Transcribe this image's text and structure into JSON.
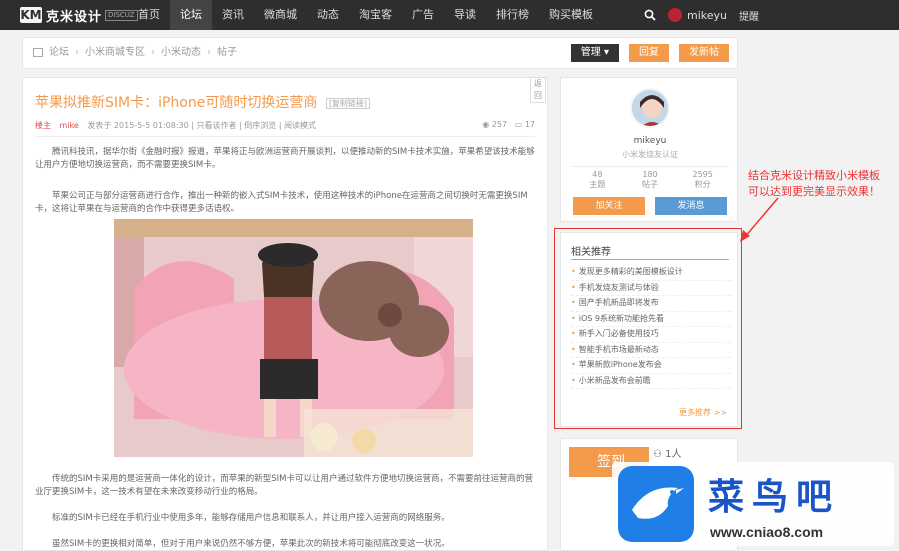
{
  "nav": {
    "logo_mark": "KM",
    "logo_text": "克米设计",
    "logo_badge": "DISCUZ",
    "items": [
      "首页",
      "论坛",
      "资讯",
      "微商城",
      "动态",
      "淘宝客",
      "广告",
      "导读",
      "排行榜",
      "购买模板"
    ],
    "active_index": 1,
    "user": "mikeyu",
    "flag": "提醒"
  },
  "breadcrumb": {
    "items": [
      "论坛",
      "小米商城专区",
      "小米动态",
      "帖子"
    ],
    "buttons": [
      "管理",
      "回复",
      "发新帖"
    ]
  },
  "article": {
    "side_tab": "返回",
    "title": "苹果拟推新SIM卡：iPhone可随时切换运营商",
    "tag": "[复制链接]",
    "author": "楼主",
    "author2": "mike",
    "meta": "发表于 2015-5-5 01:08:30 | 只看该作者 | 倒序浏览 | 阅读模式",
    "views": "257",
    "replies": "17",
    "paragraphs": [
      "腾讯科技讯，据华尔街《金融时报》报道，苹果将正与欧洲运营商开展谈判，以便推动新的SIM卡技术实施，苹果希望该技术能够让用户方便地切换运营商，而不需要更换SIM卡。",
      "苹果公司正与部分运营商进行合作，推出一种新的嵌入式SIM卡技术，使用这种技术的iPhone在运营商之间切换时无需更换SIM卡，这将让苹果在与运营商的合作中获得更多话语权。"
    ],
    "paragraphs_bottom": [
      "传统的SIM卡采用的是运营商一体化的设计，而苹果的新型SIM卡可以让用户通过软件方便地切换运营商，不需要前往运营商的营业厅更换SIM卡，这一技术有望在未来改变移动行业的格局。",
      "标准的SIM卡已经在手机行业中使用多年，能够存储用户信息和联系人，并让用户接入运营商的网络服务。",
      "虽然SIM卡的更换相对简单，但对于用户来说仍然不够方便，苹果此次的新技术将可能彻底改变这一状况。"
    ]
  },
  "profile": {
    "name": "mikeyu",
    "subtitle": "小米发烧友认证",
    "stats": [
      {
        "value": "48",
        "label": "主题"
      },
      {
        "value": "180",
        "label": "帖子"
      },
      {
        "value": "2595",
        "label": "积分"
      }
    ],
    "btn_left": "加关注",
    "btn_right": "发消息"
  },
  "related": {
    "title": "相关推荐",
    "items": [
      "发现更多精彩的美图模板设计",
      "手机发烧友测试与体验",
      "国产手机新品即将发布",
      "iOS 9系统新功能抢先看",
      "新手入门必备使用技巧",
      "智能手机市场最新动态",
      "苹果新款iPhone发布会",
      "小米新品发布会前瞻"
    ],
    "more": "更多推荐 >>"
  },
  "annotation": "结合克米设计精致小米模板\n可以达到更完美显示效果！",
  "sign": {
    "title": "签到",
    "people": "1人"
  },
  "watermark": {
    "text": "菜鸟吧",
    "url": "www.cniao8.com"
  },
  "colors": {
    "accent": "#f39b4a",
    "nav_bg": "#2e2e2e",
    "annotation": "#e33333",
    "blue": "#5b9bd5"
  }
}
